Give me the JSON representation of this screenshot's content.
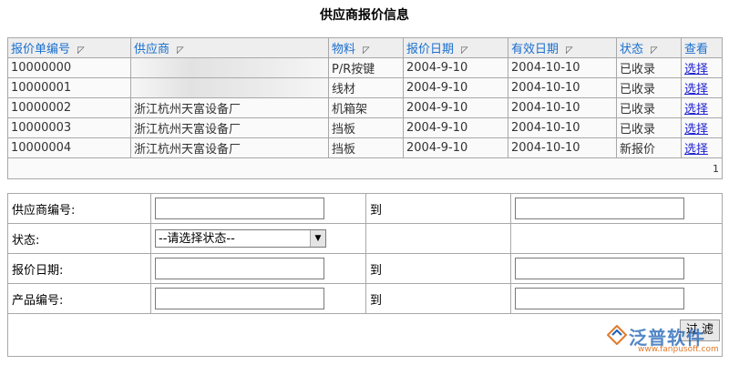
{
  "page_title": "供应商报价信息",
  "columns": [
    "报价单编号",
    "供应商",
    "物料",
    "报价日期",
    "有效日期",
    "状态",
    "查看"
  ],
  "rows": [
    {
      "id": "10000000",
      "supplier": "",
      "material": "P/R按键",
      "quote_date": "2004-9-10",
      "valid_date": "2004-10-10",
      "status": "已收录",
      "action": "选择"
    },
    {
      "id": "10000001",
      "supplier": "",
      "material": "线材",
      "quote_date": "2004-9-10",
      "valid_date": "2004-10-10",
      "status": "已收录",
      "action": "选择"
    },
    {
      "id": "10000002",
      "supplier": "浙江杭州天富设备厂",
      "material": "机箱架",
      "quote_date": "2004-9-10",
      "valid_date": "2004-10-10",
      "status": "已收录",
      "action": "选择"
    },
    {
      "id": "10000003",
      "supplier": "浙江杭州天富设备厂",
      "material": "挡板",
      "quote_date": "2004-9-10",
      "valid_date": "2004-10-10",
      "status": "已收录",
      "action": "选择"
    },
    {
      "id": "10000004",
      "supplier": "浙江杭州天富设备厂",
      "material": "挡板",
      "quote_date": "2004-9-10",
      "valid_date": "2004-10-10",
      "status": "新报价",
      "action": "选择"
    }
  ],
  "pager": "1",
  "filter": {
    "supplier_no_label": "供应商编号:",
    "to_label": "到",
    "status_label": "状态:",
    "status_value": "--请选择状态--",
    "quote_date_label": "报价日期:",
    "product_no_label": "产品编号:",
    "filter_button": "过 滤"
  },
  "logo": {
    "text": "泛普软件",
    "url": "www.fanpusoft.com"
  },
  "colors": {
    "header_text": "#1a6fcf",
    "link": "#1c1ccf",
    "border": "#a8a8a8"
  }
}
